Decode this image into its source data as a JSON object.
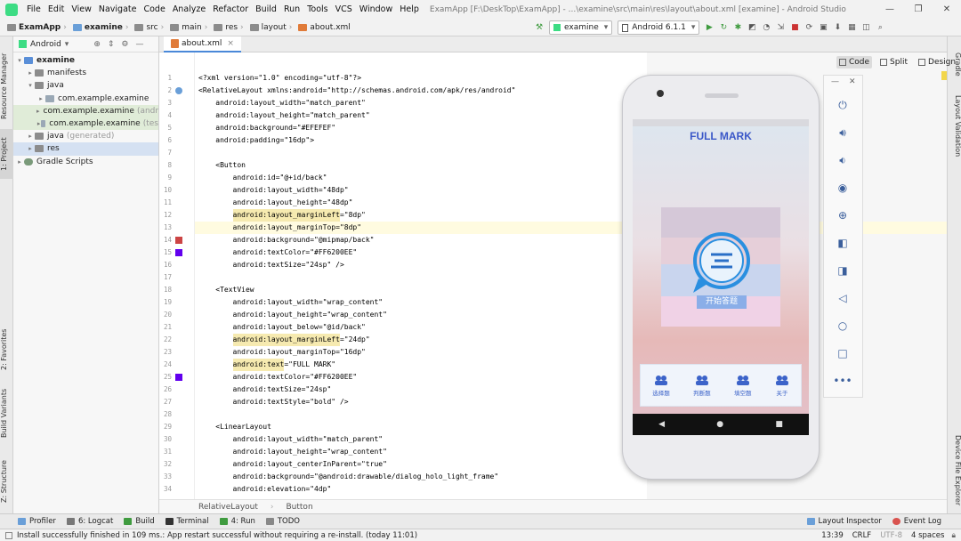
{
  "window": {
    "menu": [
      "File",
      "Edit",
      "View",
      "Navigate",
      "Code",
      "Analyze",
      "Refactor",
      "Build",
      "Run",
      "Tools",
      "VCS",
      "Window",
      "Help"
    ],
    "title": "ExamApp [F:\\DeskTop\\ExamApp] - ...\\examine\\src\\main\\res\\layout\\about.xml [examine] - Android Studio",
    "controls": [
      "—",
      "❐",
      "✕"
    ]
  },
  "navbar": {
    "crumbs": [
      "ExamApp",
      "examine",
      "src",
      "main",
      "res",
      "layout",
      "about.xml"
    ],
    "run_config": "examine",
    "device": "Android 6.1.1"
  },
  "left_strip": {
    "tabs": [
      "Resource Manager",
      "1: Project",
      "2: Favorites",
      "Build Variants",
      "Z: Structure"
    ]
  },
  "right_strip": {
    "tabs": [
      "Gradle",
      "Layout Validation",
      "Device File Explorer"
    ]
  },
  "project": {
    "view": "Android",
    "items": [
      {
        "label": "examine",
        "bold": true
      },
      {
        "label": "manifests"
      },
      {
        "label": "java"
      },
      {
        "label": "com.example.examine"
      },
      {
        "label": "com.example.examine",
        "suffix": "(andr"
      },
      {
        "label": "com.example.examine",
        "suffix": "(tes"
      },
      {
        "label": "java",
        "suffix": "(generated)"
      },
      {
        "label": "res"
      },
      {
        "label": "Gradle Scripts"
      }
    ]
  },
  "editor": {
    "tab": "about.xml",
    "modes": [
      "Code",
      "Split",
      "Design"
    ],
    "line_numbers": [
      "1",
      "2",
      "3",
      "4",
      "5",
      "6",
      "7",
      "8",
      "9",
      "10",
      "11",
      "12",
      "13",
      "14",
      "15",
      "16",
      "17",
      "18",
      "19",
      "20",
      "21",
      "22",
      "23",
      "24",
      "25",
      "26",
      "27",
      "28",
      "29",
      "30",
      "31",
      "32",
      "33",
      "34"
    ],
    "lines": [
      "<?xml version=\"1.0\" encoding=\"utf-8\"?>",
      "<RelativeLayout xmlns:android=\"http://schemas.android.com/apk/res/android\"",
      "    android:layout_width=\"match_parent\"",
      "    android:layout_height=\"match_parent\"",
      "    android:background=\"#EFEFEF\"",
      "    android:padding=\"16dp\">",
      "",
      "    <Button",
      "        android:id=\"@+id/back\"",
      "        android:layout_width=\"48dp\"",
      "        android:layout_height=\"48dp\"",
      "        android:layout_marginLeft=\"8dp\"",
      "        android:layout_marginTop=\"8dp\"",
      "        android:background=\"@mipmap/back\"",
      "        android:textColor=\"#FF6200EE\"",
      "        android:textSize=\"24sp\" />",
      "",
      "    <TextView",
      "        android:layout_width=\"wrap_content\"",
      "        android:layout_height=\"wrap_content\"",
      "        android:layout_below=\"@id/back\"",
      "        android:layout_marginLeft=\"24dp\"",
      "        android:layout_marginTop=\"16dp\"",
      "        android:text=\"FULL MARK\"",
      "        android:textColor=\"#FF6200EE\"",
      "        android:textSize=\"24sp\"",
      "        android:textStyle=\"bold\" />",
      "",
      "    <LinearLayout",
      "        android:layout_width=\"match_parent\"",
      "        android:layout_height=\"wrap_content\"",
      "        android:layout_centerInParent=\"true\"",
      "        android:background=\"@android:drawable/dialog_holo_light_frame\"",
      "        android:elevation=\"4dp\""
    ],
    "breadcrumb": [
      "RelativeLayout",
      "Button"
    ]
  },
  "phone": {
    "title": "FULL MARK",
    "start_button": "开始答题",
    "tabs": [
      "选择题",
      "判断题",
      "填空题",
      "关于"
    ],
    "nav_keys": [
      "◀",
      "●",
      "■"
    ],
    "accent": "#3a57c8"
  },
  "emulator_toolbar": {
    "controls": [
      "—",
      "✕"
    ],
    "icons": [
      "power-icon",
      "volume-up-icon",
      "volume-down-icon",
      "camera-icon",
      "zoom-icon",
      "rotate-left-icon",
      "rotate-right-icon",
      "back-icon",
      "home-icon",
      "overview-icon",
      "more-icon"
    ]
  },
  "toolwindows": {
    "left": [
      "Profiler",
      "6: Logcat",
      "Build",
      "Terminal",
      "4: Run",
      "TODO"
    ],
    "right": [
      "Layout Inspector",
      "Event Log"
    ]
  },
  "status": {
    "message": "Install successfully finished in 109 ms.: App restart successful without requiring a re-install. (today 11:01)",
    "position": "13:39",
    "line_sep": "CRLF",
    "encoding": "UTF-8",
    "indent": "4 spaces"
  }
}
